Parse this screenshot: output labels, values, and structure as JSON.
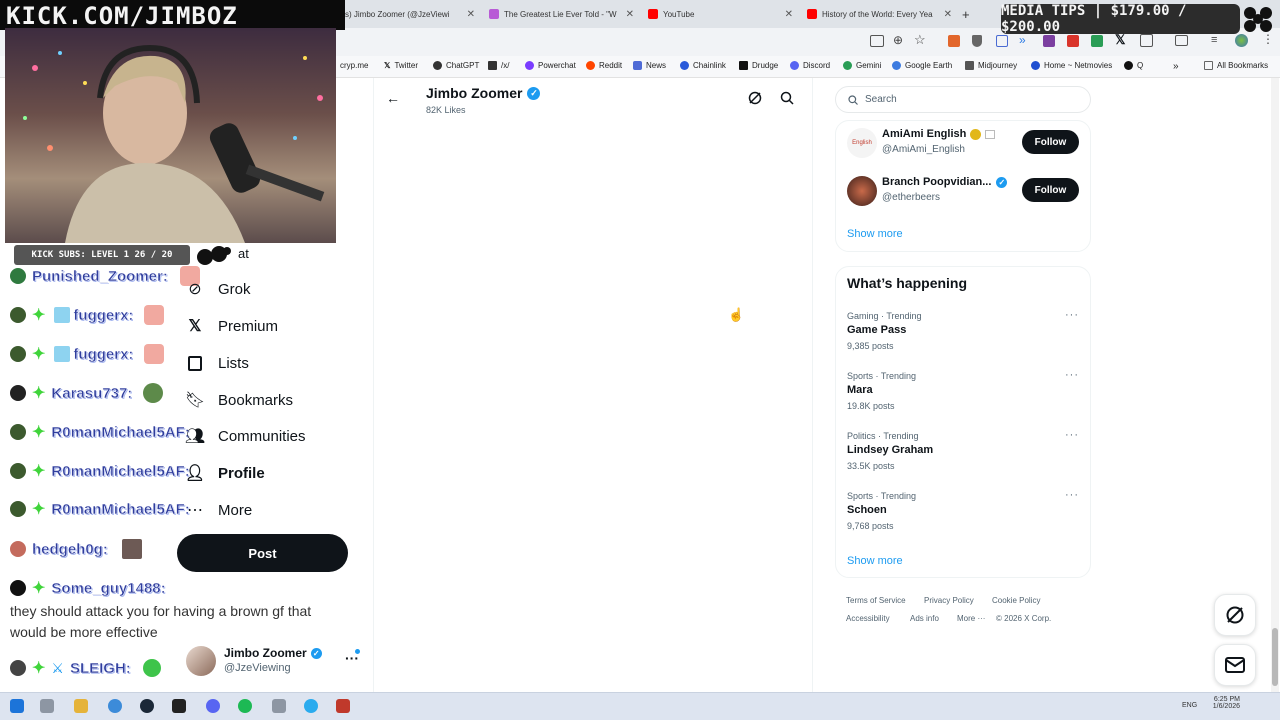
{
  "browser": {
    "tabs": [
      {
        "label": "s) Jimbo Zoomer (@JzeViewi",
        "color": "#1d9bf0"
      },
      {
        "label": "The Greatest Lie Ever Told - \"W",
        "color": "#b85bd6"
      },
      {
        "label": "YouTube",
        "color": "#ff0000"
      },
      {
        "label": "History of the World: Every Yea",
        "color": "#ff0000"
      }
    ],
    "bookmarks": [
      {
        "label": "cryp.me",
        "color": "#777"
      },
      {
        "label": "Twitter",
        "color": "#111"
      },
      {
        "label": "ChatGPT",
        "color": "#333"
      },
      {
        "label": "/x/",
        "color": "#333"
      },
      {
        "label": "Powerchat",
        "color": "#7a3cff"
      },
      {
        "label": "Reddit",
        "color": "#ff4500"
      },
      {
        "label": "News",
        "color": "#4f6bd6"
      },
      {
        "label": "Chainlink",
        "color": "#2a5ada"
      },
      {
        "label": "Drudge",
        "color": "#111"
      },
      {
        "label": "Discord",
        "color": "#5865f2"
      },
      {
        "label": "Gemini",
        "color": "#2a9d56"
      },
      {
        "label": "Google Earth",
        "color": "#3c7be0"
      },
      {
        "label": "Midjourney",
        "color": "#555"
      },
      {
        "label": "Home ~ Netmovies",
        "color": "#1f4fd1"
      },
      {
        "label": "Q",
        "color": "#111"
      },
      {
        "label": "All Bookmarks",
        "color": "#666"
      }
    ]
  },
  "overlay": {
    "kick_url": "KICK.COM/JIMBOZ",
    "media_tips": "MEDIA TIPS | $179.00 / $200.00",
    "kick_subs": "KICK SUBS: LEVEL 1 26 / 20"
  },
  "chat": [
    {
      "name": "Punished_Zoomer:"
    },
    {
      "name": "fuggerx:"
    },
    {
      "name": "fuggerx:"
    },
    {
      "name": "Karasu737:"
    },
    {
      "name": "R0manMichael5AF:"
    },
    {
      "name": "R0manMichael5AF:"
    },
    {
      "name": "R0manMichael5AF:"
    },
    {
      "name": "hedgeh0g:"
    },
    {
      "name": "Some_guy1488:"
    },
    {
      "name": "SLEIGH:"
    }
  ],
  "chat_message": "they should attack you for having a brown gf that would be more effective",
  "nav": {
    "partial": "at",
    "items": [
      "Grok",
      "Premium",
      "Lists",
      "Bookmarks",
      "Communities",
      "Profile",
      "More"
    ],
    "post_label": "Post"
  },
  "account": {
    "name": "Jimbo Zoomer",
    "handle": "@JzeViewing"
  },
  "header": {
    "title": "Jimbo Zoomer",
    "subtitle": "82K Likes"
  },
  "search": {
    "placeholder": "Search"
  },
  "who_to_follow": [
    {
      "name": "AmiAmi English",
      "handle": "@AmiAmi_English",
      "button": "Follow"
    },
    {
      "name": "Branch Poopvidian...",
      "handle": "@etherbeers",
      "button": "Follow"
    }
  ],
  "show_more": "Show more",
  "happening": {
    "title": "What’s happening",
    "trends": [
      {
        "meta": "Gaming · Trending",
        "name": "Game Pass",
        "count": "9,385 posts"
      },
      {
        "meta": "Sports · Trending",
        "name": "Mara",
        "count": "19.8K posts"
      },
      {
        "meta": "Politics · Trending",
        "name": "Lindsey Graham",
        "count": "33.5K posts"
      },
      {
        "meta": "Sports · Trending",
        "name": "Schoen",
        "count": "9,768 posts"
      }
    ],
    "show_more": "Show more"
  },
  "footer": {
    "terms": "Terms of Service",
    "privacy": "Privacy Policy",
    "cookie": "Cookie Policy",
    "accessibility": "Accessibility",
    "ads": "Ads info",
    "more": "More ···",
    "copyright": "© 2026 X Corp."
  },
  "taskbar": {
    "lang": "ENG",
    "time": "6:25 PM",
    "date": "1/6/2026"
  }
}
